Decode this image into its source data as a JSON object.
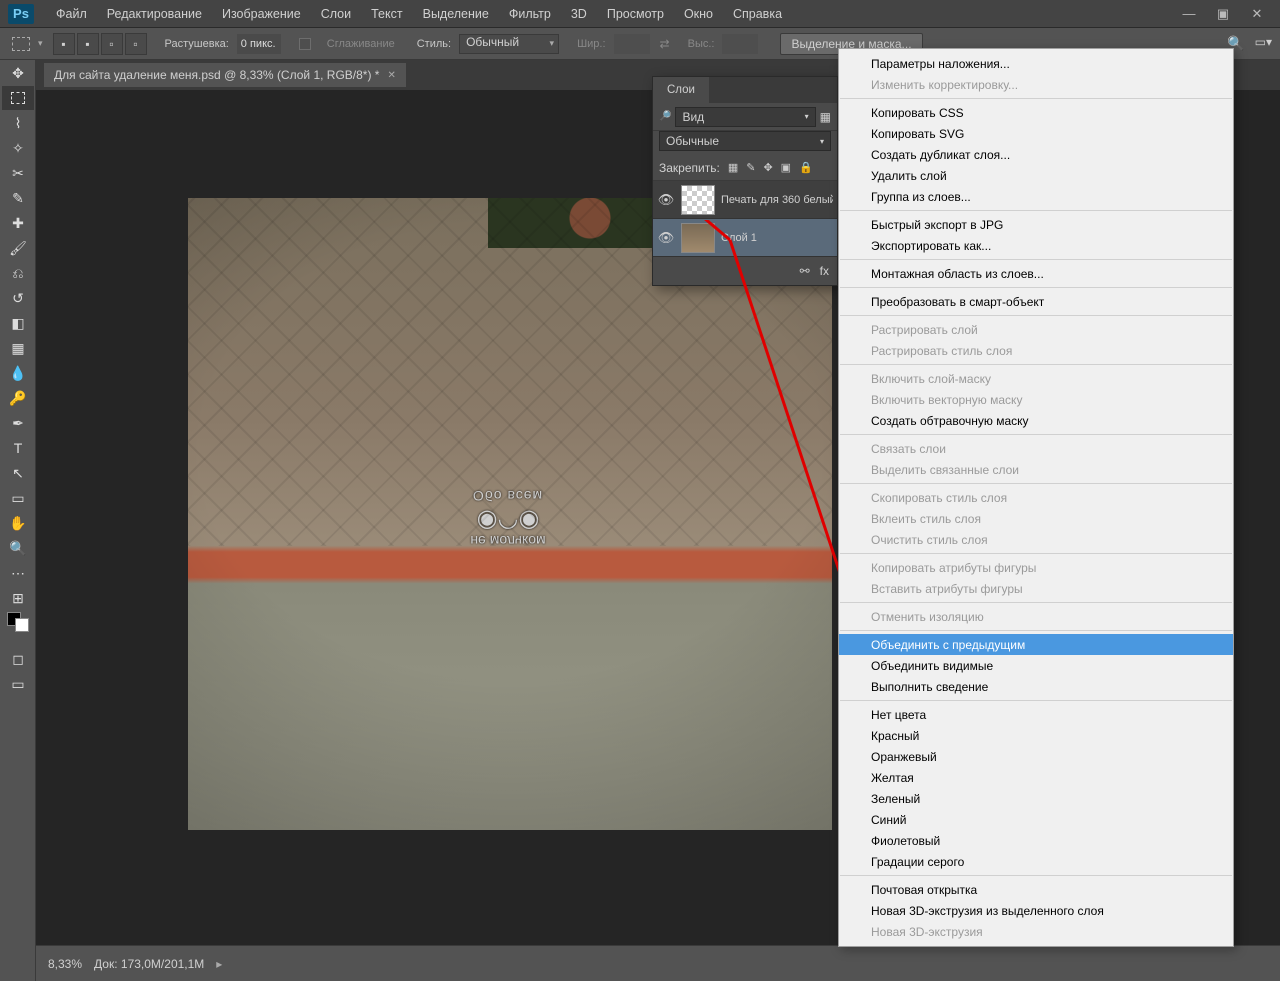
{
  "app": {
    "logo": "Ps"
  },
  "menubar": [
    "Файл",
    "Редактирование",
    "Изображение",
    "Слои",
    "Текст",
    "Выделение",
    "Фильтр",
    "3D",
    "Просмотр",
    "Окно",
    "Справка"
  ],
  "optbar": {
    "feather_label": "Растушевка:",
    "feather_value": "0 пикс.",
    "antialias": "Сглаживание",
    "style_label": "Стиль:",
    "style_value": "Обычный",
    "width_label": "Шир.:",
    "height_label": "Выс.:",
    "refine": "Выделение и маска..."
  },
  "doc_tab": {
    "title": "Для сайта удаление меня.psd @ 8,33% (Слой 1, RGB/8*) *"
  },
  "watermark": {
    "top": "Обо всем",
    "bottom": "не молчком"
  },
  "status": {
    "zoom": "8,33%",
    "doc_label": "Док:",
    "doc_value": "173,0M/201,1M"
  },
  "layers": {
    "tab": "Слои",
    "filter_kind": "Вид",
    "blend": "Обычные",
    "lock_label": "Закрепить:",
    "rows": [
      {
        "name": "Печать для 360 белый дл..."
      },
      {
        "name": "Слой 1"
      }
    ]
  },
  "ctx": [
    {
      "t": "Параметры наложения..."
    },
    {
      "t": "Изменить корректировку...",
      "dis": true
    },
    {
      "sep": true
    },
    {
      "t": "Копировать CSS"
    },
    {
      "t": "Копировать SVG"
    },
    {
      "t": "Создать дубликат слоя..."
    },
    {
      "t": "Удалить слой"
    },
    {
      "t": "Группа из слоев..."
    },
    {
      "sep": true
    },
    {
      "t": "Быстрый экспорт в JPG"
    },
    {
      "t": "Экспортировать как..."
    },
    {
      "sep": true
    },
    {
      "t": "Монтажная область из слоев..."
    },
    {
      "sep": true
    },
    {
      "t": "Преобразовать в смарт-объект"
    },
    {
      "sep": true
    },
    {
      "t": "Растрировать слой",
      "dis": true
    },
    {
      "t": "Растрировать стиль слоя",
      "dis": true
    },
    {
      "sep": true
    },
    {
      "t": "Включить слой-маску",
      "dis": true
    },
    {
      "t": "Включить векторную маску",
      "dis": true
    },
    {
      "t": "Создать обтравочную маску"
    },
    {
      "sep": true
    },
    {
      "t": "Связать слои",
      "dis": true
    },
    {
      "t": "Выделить связанные слои",
      "dis": true
    },
    {
      "sep": true
    },
    {
      "t": "Скопировать стиль слоя",
      "dis": true
    },
    {
      "t": "Вклеить стиль слоя",
      "dis": true
    },
    {
      "t": "Очистить стиль слоя",
      "dis": true
    },
    {
      "sep": true
    },
    {
      "t": "Копировать атрибуты фигуры",
      "dis": true
    },
    {
      "t": "Вставить атрибуты фигуры",
      "dis": true
    },
    {
      "sep": true
    },
    {
      "t": "Отменить изоляцию",
      "dis": true
    },
    {
      "sep": true
    },
    {
      "t": "Объединить с предыдущим",
      "hl": true
    },
    {
      "t": "Объединить видимые"
    },
    {
      "t": "Выполнить сведение"
    },
    {
      "sep": true
    },
    {
      "t": "Нет цвета"
    },
    {
      "t": "Красный"
    },
    {
      "t": "Оранжевый"
    },
    {
      "t": "Желтая"
    },
    {
      "t": "Зеленый"
    },
    {
      "t": "Синий"
    },
    {
      "t": "Фиолетовый"
    },
    {
      "t": "Градации серого"
    },
    {
      "sep": true
    },
    {
      "t": "Почтовая открытка"
    },
    {
      "t": "Новая 3D-экструзия из выделенного слоя"
    },
    {
      "t": "Новая 3D-экструзия",
      "dis": true
    }
  ]
}
